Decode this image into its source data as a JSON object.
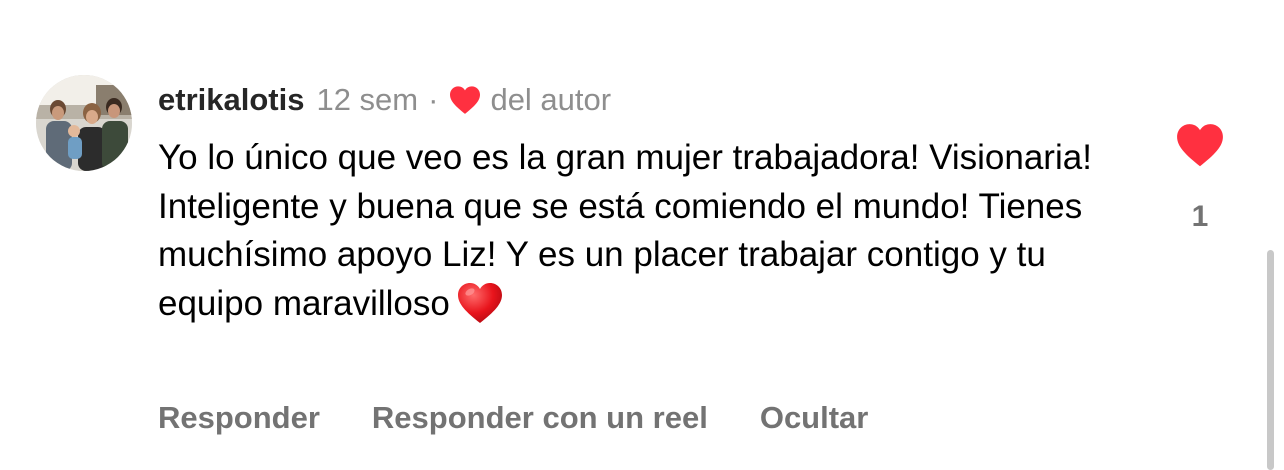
{
  "comment": {
    "username": "etrikalotis",
    "time": "12 sem",
    "separator": "·",
    "author_like_label": "del autor",
    "text": "Yo lo único que veo es la gran mujer trabajadora! Visionaria! Inteligente y buena que se está comiendo el mundo! Tienes muchísimo apoyo Liz! Y es un placer trabajar contigo y tu equipo maravilloso",
    "text_emoji": "red-heart-emoji",
    "like_count": "1",
    "actions": {
      "reply": "Responder",
      "reply_reel": "Responder con un reel",
      "hide": "Ocultar"
    }
  },
  "icons": {
    "author_heart": "heart-filled-icon",
    "like": "heart-filled-icon"
  },
  "colors": {
    "heart": "#ff3040",
    "username": "#262626",
    "secondary": "#8e8e8e",
    "action": "#737373"
  }
}
